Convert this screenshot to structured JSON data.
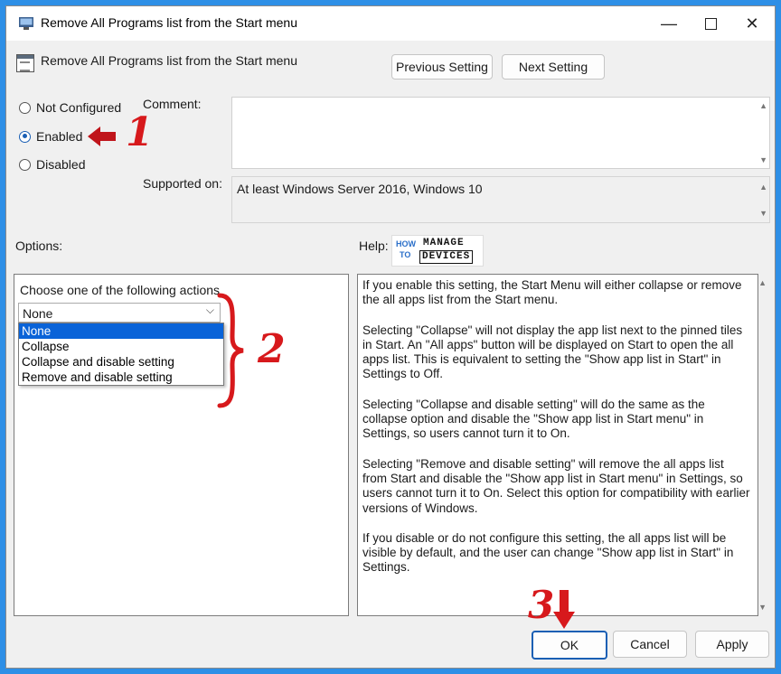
{
  "window": {
    "title": "Remove All Programs list from the Start menu",
    "controls": {
      "minimize": "—",
      "maximize": "",
      "close": "✕"
    }
  },
  "header": {
    "policy_name": "Remove All Programs list from the Start menu",
    "prev_button": "Previous Setting",
    "next_button": "Next Setting"
  },
  "state": {
    "options": [
      {
        "label": "Not Configured",
        "selected": false
      },
      {
        "label": "Enabled",
        "selected": true
      },
      {
        "label": "Disabled",
        "selected": false
      }
    ]
  },
  "comment": {
    "label": "Comment:",
    "value": ""
  },
  "supported": {
    "label": "Supported on:",
    "value": "At least Windows Server 2016, Windows 10"
  },
  "options_panel": {
    "label": "Options:",
    "prompt": "Choose one of the following actions",
    "selected_value": "None",
    "items": [
      "None",
      "Collapse",
      "Collapse and disable setting",
      "Remove and disable setting"
    ]
  },
  "help_panel": {
    "label": "Help:",
    "brand": {
      "how": "HOW",
      "to": "TO",
      "manage": "MANAGE",
      "devices": "DEVICES"
    },
    "paragraphs": [
      "If you enable this setting, the Start Menu will either collapse or remove the all apps list from the Start menu.",
      "Selecting \"Collapse\" will not display the app list next to the pinned tiles in Start. An \"All apps\" button will be displayed on Start to open the all apps list. This is equivalent to setting the \"Show app list in Start\" in Settings to Off.",
      "Selecting \"Collapse and disable setting\" will do the same as the collapse option and disable the \"Show app list in Start menu\" in Settings, so users cannot turn it to On.",
      "Selecting \"Remove and disable setting\" will remove the all apps list from Start and disable the \"Show app list in Start menu\" in Settings, so users cannot turn it to On. Select this option for compatibility with earlier versions of Windows.",
      "If you disable or do not configure this setting, the all apps list will be visible by default, and the user can change \"Show app list in Start\" in Settings."
    ]
  },
  "footer": {
    "ok": "OK",
    "cancel": "Cancel",
    "apply": "Apply"
  },
  "annotations": {
    "step1": "1",
    "step2": "2",
    "step3": "3"
  },
  "colors": {
    "accent": "#0a63d8",
    "annotation": "#d7191c",
    "frame": "#2e8fe6"
  },
  "icons": [
    "app-icon",
    "policy-icon",
    "minimize-icon",
    "maximize-icon",
    "close-icon",
    "chevron-down-icon",
    "scroll-up-icon",
    "scroll-down-icon",
    "arrow-left-icon",
    "arrow-down-icon",
    "brace-icon"
  ]
}
